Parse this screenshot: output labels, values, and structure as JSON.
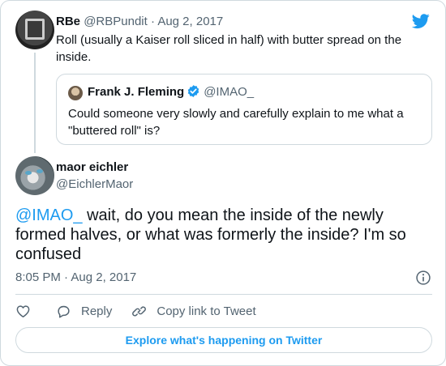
{
  "parent_tweet": {
    "name": "RBe",
    "handle": "@RBPundit",
    "separator": "·",
    "date": "Aug 2, 2017",
    "text": "Roll (usually a Kaiser roll sliced in half) with butter spread on the inside."
  },
  "quoted_tweet": {
    "name": "Frank J. Fleming",
    "handle": "@IMAO_",
    "text": "Could someone very slowly and carefully explain to me what a \"buttered roll\" is?"
  },
  "main_tweet": {
    "name": "maor eichler",
    "handle": "@EichlerMaor",
    "mention": "@IMAO_",
    "text": " wait, do you mean the inside of the newly formed halves, or what was formerly the inside? I'm so confused",
    "timestamp": "8:05 PM · Aug 2, 2017"
  },
  "actions": {
    "reply_label": "Reply",
    "copy_link_label": "Copy link to Tweet"
  },
  "explore_label": "Explore what's happening on Twitter",
  "icons": {
    "brand": "twitter-bird-icon",
    "verified": "verified-badge-icon",
    "info": "info-icon",
    "like": "heart-icon",
    "reply": "speech-bubble-icon",
    "link": "link-icon"
  },
  "colors": {
    "accent": "#1d9bf0",
    "text": "#0f1419",
    "muted": "#536471",
    "border": "#cfd9de"
  }
}
